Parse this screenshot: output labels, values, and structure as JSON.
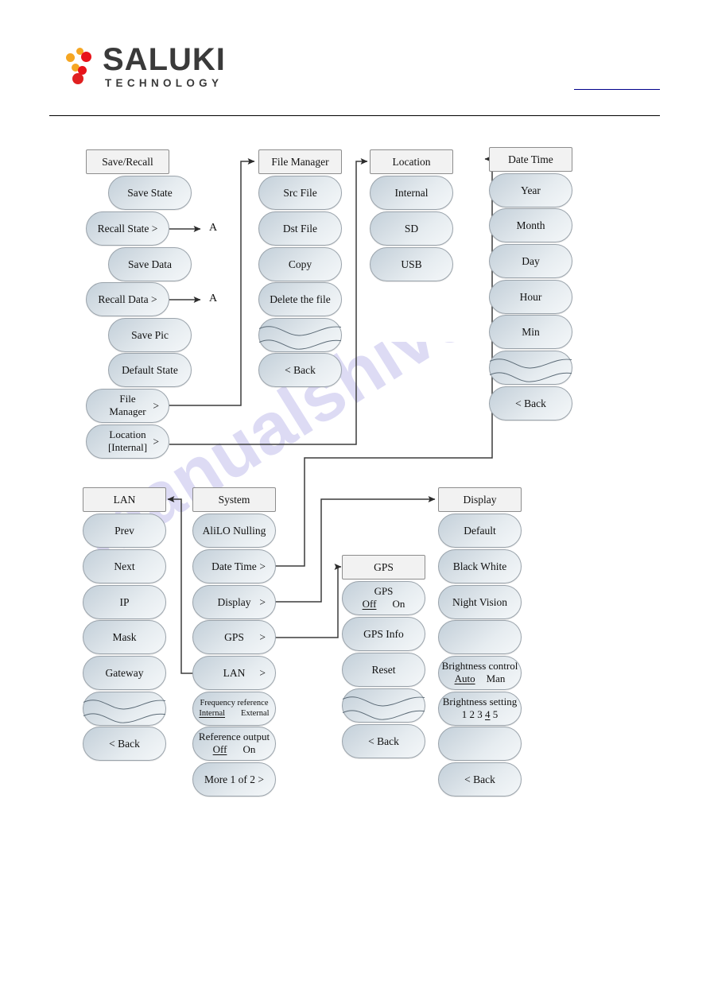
{
  "header": {
    "logo_title": "SALUKI",
    "logo_subtitle": "TECHNOLOGY",
    "watermark_text": "manualshive.com"
  },
  "colors": {
    "logo_red": "#e8131a",
    "logo_orange": "#f5a623",
    "logo_text": "#3a3a3a",
    "header_link": "#00008b",
    "button_border": "#9aa3ab",
    "button_grad_top": "#c3d0da",
    "button_grad_bottom": "#f4f7f9",
    "header_button_fill": "#f2f2f2",
    "wire": "#3c3c3c",
    "watermark": "#b9b6ea"
  },
  "branch_labels": [
    {
      "id": "branch-a-recall-state",
      "text": "A"
    },
    {
      "id": "branch-a-recall-data",
      "text": "A"
    }
  ],
  "columns": [
    {
      "id": "save-recall",
      "title": "Save/Recall",
      "items": [
        {
          "label": "Save State",
          "type": "plain"
        },
        {
          "label": "Recall State >",
          "type": "plain"
        },
        {
          "label": "Save Data",
          "type": "plain"
        },
        {
          "label": "Recall Data >",
          "type": "plain"
        },
        {
          "label": "Save Pic",
          "type": "plain"
        },
        {
          "label": "Default State",
          "type": "plain"
        },
        {
          "label": "File Manager",
          "line1": "File",
          "line2": "Manager",
          "chevron": ">",
          "type": "two-line-chevron"
        },
        {
          "label": "Location [Internal]",
          "line1": "Location",
          "line2": "[Internal]",
          "chevron": ">",
          "type": "two-line-chevron"
        }
      ]
    },
    {
      "id": "file-manager",
      "title": "File Manager",
      "items": [
        {
          "label": "Src File",
          "type": "plain"
        },
        {
          "label": "Dst File",
          "type": "plain"
        },
        {
          "label": "Copy",
          "type": "plain"
        },
        {
          "label": "Delete the file",
          "type": "plain"
        },
        {
          "label": "",
          "type": "squiggle"
        },
        {
          "label": "<    Back",
          "type": "back"
        }
      ]
    },
    {
      "id": "location",
      "title": "Location",
      "items": [
        {
          "label": "Internal",
          "type": "plain"
        },
        {
          "label": "SD",
          "type": "plain"
        },
        {
          "label": "USB",
          "type": "plain"
        }
      ]
    },
    {
      "id": "date-time",
      "title": "Date Time",
      "items": [
        {
          "label": "Year",
          "type": "plain"
        },
        {
          "label": "Month",
          "type": "plain"
        },
        {
          "label": "Day",
          "type": "plain"
        },
        {
          "label": "Hour",
          "type": "plain"
        },
        {
          "label": "Min",
          "type": "plain"
        },
        {
          "label": "",
          "type": "squiggle"
        },
        {
          "label": "<    Back",
          "type": "back"
        }
      ]
    },
    {
      "id": "lan",
      "title": "LAN",
      "items": [
        {
          "label": "Prev",
          "type": "plain"
        },
        {
          "label": "Next",
          "type": "plain"
        },
        {
          "label": "IP",
          "type": "plain"
        },
        {
          "label": "Mask",
          "type": "plain"
        },
        {
          "label": "Gateway",
          "type": "plain"
        },
        {
          "label": "",
          "type": "squiggle"
        },
        {
          "label": "<    Back",
          "type": "back"
        }
      ]
    },
    {
      "id": "system",
      "title": "System",
      "items": [
        {
          "label": "AliLO Nulling",
          "type": "plain"
        },
        {
          "label": "Date Time",
          "chevron": ">",
          "type": "chevron"
        },
        {
          "label": "Display",
          "chevron": ">",
          "type": "chevron"
        },
        {
          "label": "GPS",
          "chevron": ">",
          "type": "chevron"
        },
        {
          "label": "LAN",
          "chevron": ">",
          "type": "chevron"
        },
        {
          "label": "Frequency reference",
          "line1": "Frequency reference",
          "options": [
            {
              "text": "Internal",
              "selected": true
            },
            {
              "text": "External",
              "selected": false
            }
          ],
          "type": "toggle-small"
        },
        {
          "label": "Reference output",
          "line1": "Reference output",
          "options": [
            {
              "text": "Off",
              "selected": true
            },
            {
              "text": "On",
              "selected": false
            }
          ],
          "type": "toggle"
        },
        {
          "label": "More 1 of 2 >",
          "type": "plain"
        }
      ]
    },
    {
      "id": "gps",
      "title": "GPS",
      "items": [
        {
          "label": "GPS",
          "line1": "GPS",
          "options": [
            {
              "text": "Off",
              "selected": true
            },
            {
              "text": "On",
              "selected": false
            }
          ],
          "type": "toggle"
        },
        {
          "label": "GPS Info",
          "type": "plain"
        },
        {
          "label": "Reset",
          "type": "plain"
        },
        {
          "label": "",
          "type": "squiggle"
        },
        {
          "label": "<    Back",
          "type": "back"
        }
      ]
    },
    {
      "id": "display",
      "title": "Display",
      "items": [
        {
          "label": "Default",
          "type": "plain"
        },
        {
          "label": "Black White",
          "type": "plain"
        },
        {
          "label": "Night Vision",
          "type": "plain"
        },
        {
          "label": "",
          "type": "blank"
        },
        {
          "label": "Brightness control",
          "line1": "Brightness control",
          "options": [
            {
              "text": "Auto",
              "selected": true
            },
            {
              "text": "Man",
              "selected": false
            }
          ],
          "type": "toggle"
        },
        {
          "label": "Brightness setting",
          "line1": "Brightness setting",
          "options": [
            {
              "text": "1",
              "selected": false
            },
            {
              "text": "2",
              "selected": false
            },
            {
              "text": "3",
              "selected": false
            },
            {
              "text": "4",
              "selected": true
            },
            {
              "text": "5",
              "selected": false
            }
          ],
          "type": "toggle-nums"
        },
        {
          "label": "",
          "type": "blank"
        },
        {
          "label": "<    Back",
          "type": "back"
        }
      ]
    }
  ]
}
